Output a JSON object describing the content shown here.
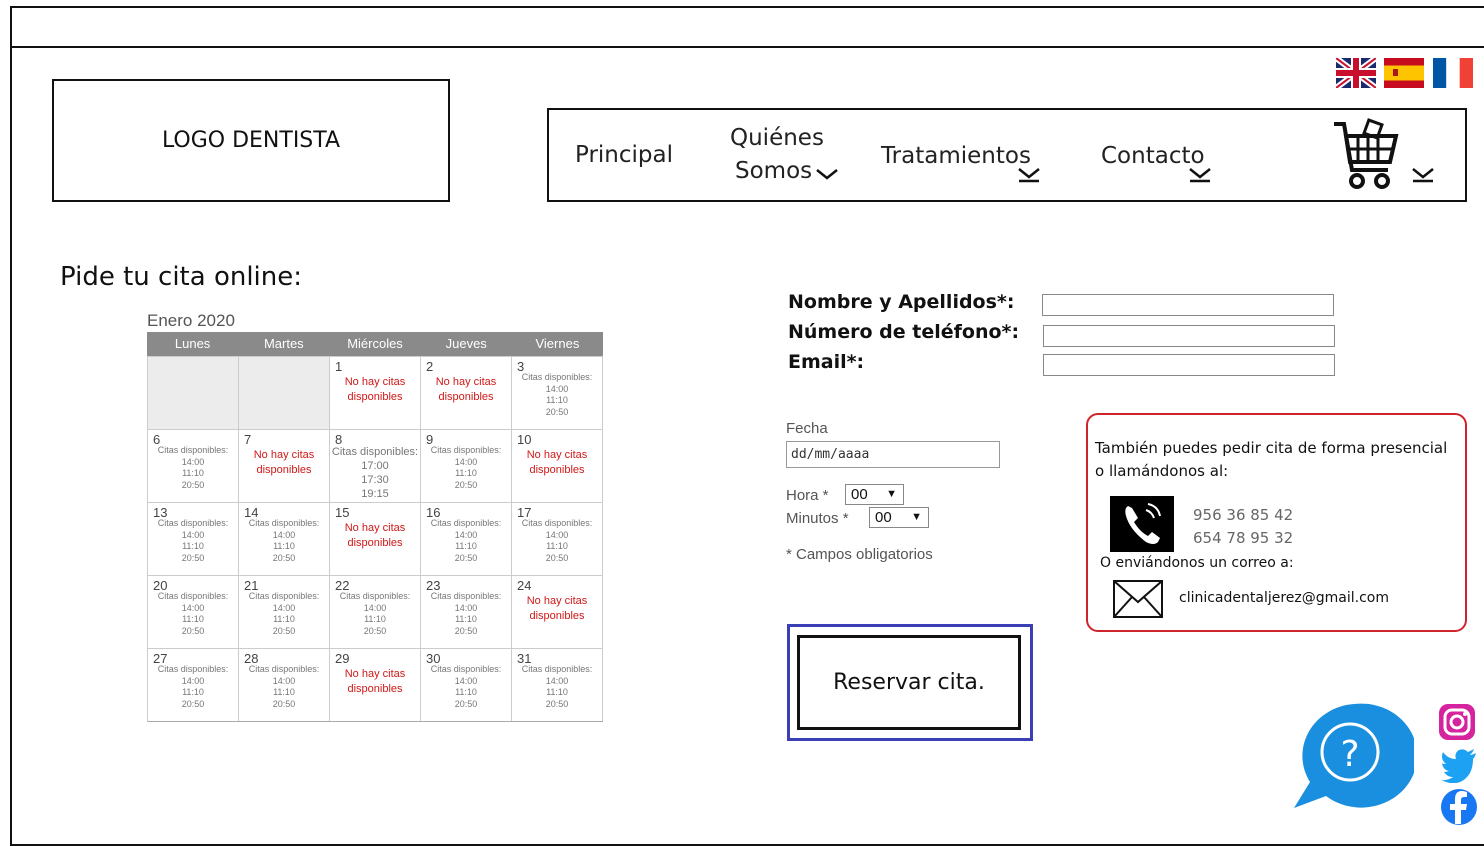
{
  "logo": {
    "text": "LOGO DENTISTA"
  },
  "flags": [
    "flag-uk-icon",
    "flag-es-icon",
    "flag-fr-icon"
  ],
  "nav": {
    "principal": "Principal",
    "quienes_line1": "Quiénes",
    "quienes_line2": "Somos",
    "tratamientos": "Tratamientos",
    "contacto": "Contacto"
  },
  "page": {
    "title": "Pide tu cita online:"
  },
  "calendar": {
    "month": "Enero 2020",
    "days": [
      "Lunes",
      "Martes",
      "Miércoles",
      "Jueves",
      "Viernes"
    ],
    "available_label": "Citas disponibles:",
    "no_citas": [
      "No hay citas",
      "disponibles"
    ],
    "cells": [
      {
        "day": "",
        "status": "empty"
      },
      {
        "day": "",
        "status": "empty"
      },
      {
        "day": "1",
        "status": "none"
      },
      {
        "day": "2",
        "status": "none"
      },
      {
        "day": "3",
        "status": "avail",
        "times": [
          "14:00",
          "11:10",
          "20:50"
        ]
      },
      {
        "day": "6",
        "status": "avail",
        "times": [
          "14:00",
          "11:10",
          "20:50"
        ]
      },
      {
        "day": "7",
        "status": "none"
      },
      {
        "day": "8",
        "status": "avail",
        "times": [
          "17:00",
          "17:30",
          "19:15"
        ]
      },
      {
        "day": "9",
        "status": "avail",
        "times": [
          "14:00",
          "11:10",
          "20:50"
        ]
      },
      {
        "day": "10",
        "status": "none"
      },
      {
        "day": "13",
        "status": "avail",
        "times": [
          "14:00",
          "11:10",
          "20:50"
        ]
      },
      {
        "day": "14",
        "status": "avail",
        "times": [
          "14:00",
          "11:10",
          "20:50"
        ]
      },
      {
        "day": "15",
        "status": "none"
      },
      {
        "day": "16",
        "status": "avail",
        "times": [
          "14:00",
          "11:10",
          "20:50"
        ]
      },
      {
        "day": "17",
        "status": "avail",
        "times": [
          "14:00",
          "11:10",
          "20:50"
        ]
      },
      {
        "day": "20",
        "status": "avail",
        "times": [
          "14:00",
          "11:10",
          "20:50"
        ]
      },
      {
        "day": "21",
        "status": "avail",
        "times": [
          "14:00",
          "11:10",
          "20:50"
        ]
      },
      {
        "day": "22",
        "status": "avail",
        "times": [
          "14:00",
          "11:10",
          "20:50"
        ]
      },
      {
        "day": "23",
        "status": "avail",
        "times": [
          "14:00",
          "11:10",
          "20:50"
        ]
      },
      {
        "day": "24",
        "status": "none"
      },
      {
        "day": "27",
        "status": "avail",
        "times": [
          "14:00",
          "11:10",
          "20:50"
        ]
      },
      {
        "day": "28",
        "status": "avail",
        "times": [
          "14:00",
          "11:10",
          "20:50"
        ]
      },
      {
        "day": "29",
        "status": "none"
      },
      {
        "day": "30",
        "status": "avail",
        "times": [
          "14:00",
          "11:10",
          "20:50"
        ]
      },
      {
        "day": "31",
        "status": "avail",
        "times": [
          "14:00",
          "11:10",
          "20:50"
        ]
      }
    ]
  },
  "form": {
    "name_label": "Nombre y Apellidos*:",
    "phone_label": "Número de teléfono*:",
    "email_label": "Email*:",
    "name_value": "",
    "phone_value": "",
    "email_value": "",
    "fecha_label": "Fecha",
    "date_placeholder": "dd/mm/aaaa",
    "hora_label": "Hora *",
    "hora_value": "00",
    "minutos_label": "Minutos *",
    "minutos_value": "00",
    "required_note": "* Campos obligatorios",
    "submit_label": "Reservar cita."
  },
  "contact": {
    "line1": "También puedes pedir cita de forma presencial",
    "line2": "o llamándonos al:",
    "phone1": "956 36 85 42",
    "phone2": "654 78 95 32",
    "email_intro": "O enviándonos un correo a:",
    "email": "clinicadentaljerez@gmail.com"
  },
  "colors": {
    "accent_red": "#d0242c",
    "button_border": "#3b3fb5",
    "help_blue": "#1a8fe0",
    "calendar_header": "#8a8a8a"
  }
}
